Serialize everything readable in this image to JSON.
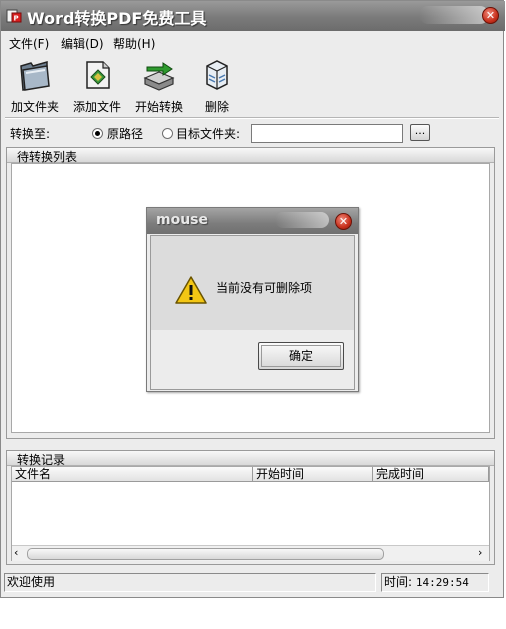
{
  "window": {
    "title": "Word转换PDF免费工具"
  },
  "menu": [
    {
      "label": "文件(F)"
    },
    {
      "label": "编辑(D)"
    },
    {
      "label": "帮助(H)"
    }
  ],
  "toolbar": [
    {
      "label": "加文件夹",
      "icon": "folder-icon"
    },
    {
      "label": "添加文件",
      "icon": "add-file-icon"
    },
    {
      "label": "开始转换",
      "icon": "start-convert-icon"
    },
    {
      "label": "删除",
      "icon": "delete-icon"
    }
  ],
  "output": {
    "label": "转换至:",
    "option_original": "原路径",
    "option_target": "目标文件夹:",
    "selected": "原路径",
    "path_value": "",
    "browse_label": "..."
  },
  "pending_list": {
    "title": "待转换列表"
  },
  "records": {
    "title": "转换记录",
    "columns": [
      "文件名",
      "开始时间",
      "完成时间"
    ],
    "rows": []
  },
  "status": {
    "message": "欢迎使用",
    "time_label": "时间:",
    "time_value": "14:29:54"
  },
  "dialog": {
    "title": "mouse",
    "message": "当前没有可删除项",
    "ok_label": "确定",
    "icon": "warning-icon"
  }
}
